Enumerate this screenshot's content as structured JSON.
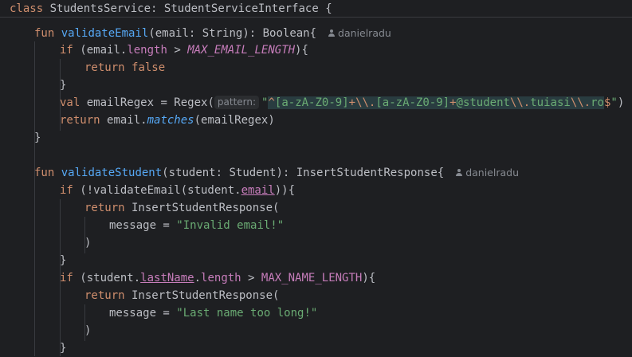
{
  "editor": {
    "class_line": {
      "kw_class": "class",
      "class_name": "StudentsService",
      "colon": ":",
      "interface": "StudentServiceInterface",
      "brace": "{"
    },
    "author": "danielradu",
    "validate_email": {
      "kw_fun": "fun",
      "name": "validateEmail",
      "params": "(email: String): Boolean{",
      "if_kw": "if",
      "if_open": "(email.",
      "length_prop": "length",
      "gt": " > ",
      "max_email_const": "MAX_EMAIL_LENGTH",
      "if_close": "){",
      "return_kw": "return",
      "false_kw": "false",
      "close_brace": "}",
      "val_kw": "val",
      "regex_decl": "emailRegex = Regex(",
      "param_hint": "pattern:",
      "regex_quote_open": "\"",
      "rx_caret": "^",
      "rx_class1": "[a-zA-Z0-9]",
      "rx_plus1": "+",
      "rx_esc_dot1": "\\\\.",
      "rx_class2": "[a-zA-Z0-9]",
      "rx_plus2": "+",
      "rx_at": "@student",
      "rx_esc_dot2": "\\\\.",
      "rx_tuiasi": "tuiasi",
      "rx_esc_dot3": "\\\\.",
      "rx_ro": "ro",
      "rx_dollar": "$",
      "regex_quote_close": "\"",
      "regex_paren_close": ")",
      "return_line_pre": "email.",
      "matches_fn": "matches",
      "return_line_post": "(emailRegex)",
      "fn_close": "}"
    },
    "validate_student": {
      "kw_fun": "fun",
      "name": "validateStudent",
      "params": "(student: Student): InsertStudentResponse{",
      "if1_kw": "if",
      "if1_open": " (!validateEmail(student.",
      "email_prop": "email",
      "if1_close": ")){",
      "return1_kw": "return",
      "return1_call": " InsertStudentResponse(",
      "msg1_pre": "message = ",
      "msg1_str": "\"Invalid email!\"",
      "paren1_close": ")",
      "brace1_close": "}",
      "if2_kw": "if",
      "if2_open": " (student.",
      "lastname_prop": "lastName",
      "if2_mid": ".",
      "length_prop2": "length",
      "gt2": " > ",
      "max_name_const": "MAX_NAME_LENGTH",
      "if2_close": "){",
      "return2_kw": "return",
      "return2_call": " InsertStudentResponse(",
      "msg2_pre": "message = ",
      "msg2_str": "\"Last name too long!\"",
      "paren2_close": ")",
      "brace2_close": "}"
    }
  },
  "colors": {
    "background": "#1e1f22",
    "text": "#bcbec4",
    "keyword": "#cf8e6d",
    "function": "#56a8f5",
    "string": "#6aab73",
    "constant": "#c77dbb",
    "hint": "#868a91"
  }
}
